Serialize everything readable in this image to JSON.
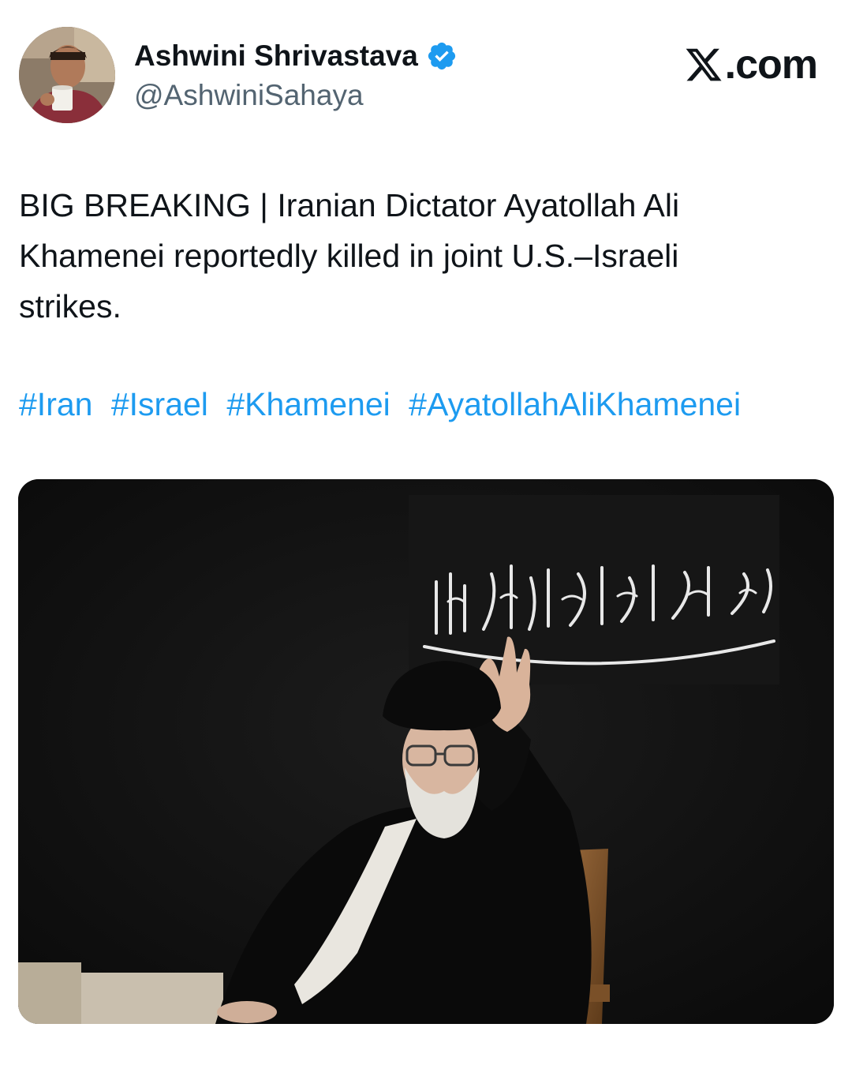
{
  "author": {
    "display_name": "Ashwini Shrivastava",
    "handle": "@AshwiniSahaya",
    "verified": true,
    "avatar_icon": "profile-photo"
  },
  "brand": {
    "label": ".com",
    "icon": "x-logo-icon"
  },
  "tweet": {
    "text": "BIG BREAKING | Iranian Dictator Ayatollah Ali\nKhamenei reportedly killed in joint U.S.–Israeli\nstrikes.",
    "hashtags": [
      "#Iran",
      "#Israel",
      "#Khamenei",
      "#AyatollahAliKhamenei"
    ]
  },
  "media": {
    "type": "photo",
    "banner_text": "صلی الله علیک یا اباعبدالله"
  },
  "colors": {
    "hashtag": "#1d9bf0",
    "verified_badge": "#1d9bf0",
    "text": "#0f1419",
    "secondary": "#536471"
  }
}
